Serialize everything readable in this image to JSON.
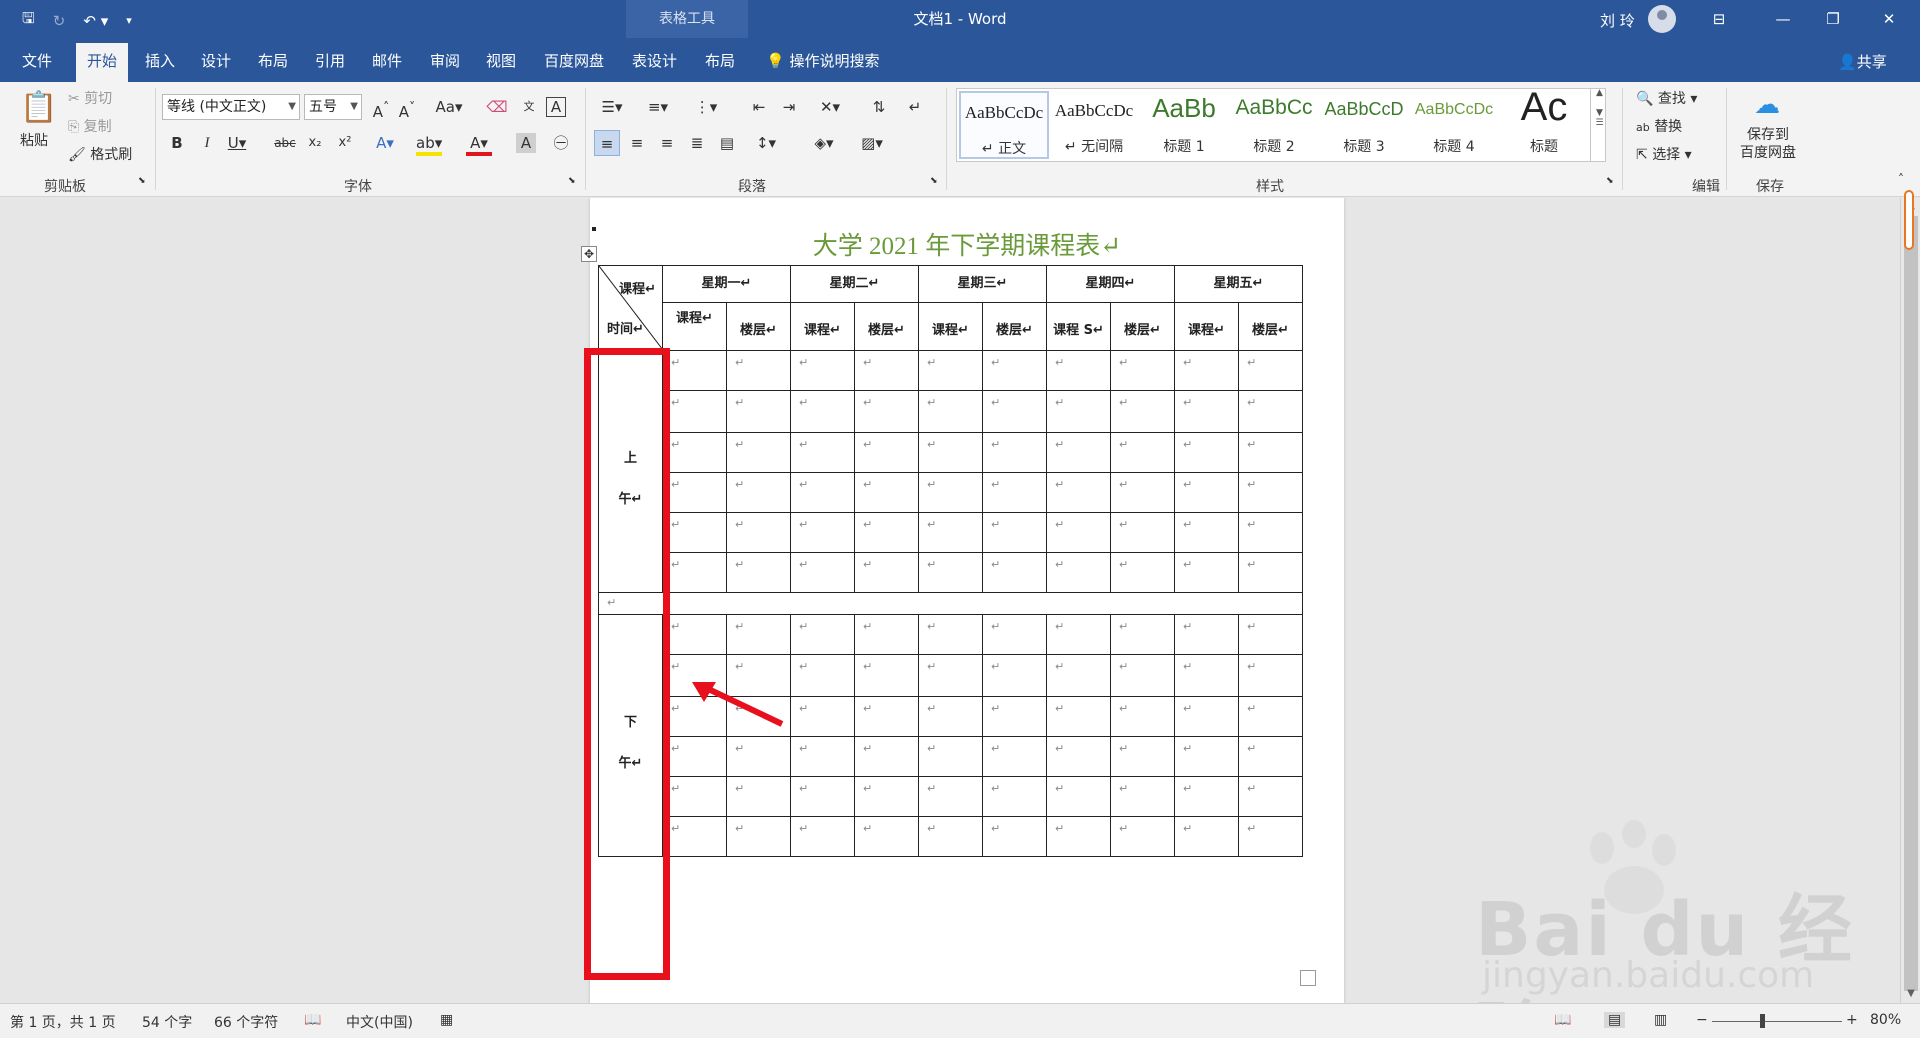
{
  "titlebar": {
    "context_tools": "表格工具",
    "doc_title": "文档1  -  Word",
    "user_name": "刘 玲"
  },
  "tabs": [
    "文件",
    "开始",
    "插入",
    "设计",
    "布局",
    "引用",
    "邮件",
    "审阅",
    "视图",
    "百度网盘",
    "表设计",
    "布局"
  ],
  "tell_me": "操作说明搜索",
  "share": "共享",
  "ribbon": {
    "clipboard": {
      "paste": "粘贴",
      "cut": "剪切",
      "copy": "复制",
      "format_painter": "格式刷",
      "label": "剪贴板"
    },
    "font": {
      "font_name": "等线 (中文正文)",
      "font_size": "五号",
      "label": "字体"
    },
    "paragraph": {
      "label": "段落"
    },
    "styles": {
      "label": "样式",
      "items": [
        {
          "sample": "AaBbCcDc",
          "name": "↵ 正文"
        },
        {
          "sample": "AaBbCcDc",
          "name": "↵ 无间隔"
        },
        {
          "sample": "AaBb",
          "name": "标题 1"
        },
        {
          "sample": "AaBbCc",
          "name": "标题 2"
        },
        {
          "sample": "AaBbCcD",
          "name": "标题 3"
        },
        {
          "sample": "AaBbCcDc",
          "name": "标题 4"
        },
        {
          "sample": "Ac",
          "name": "标题"
        }
      ]
    },
    "editing": {
      "find": "查找",
      "replace": "替换",
      "select": "选择",
      "label": "编辑"
    },
    "save": {
      "button": "保存到\n百度网盘",
      "label": "保存"
    }
  },
  "document": {
    "title": "大学 2021 年下学期课程表↵",
    "header": {
      "corner_top": "课程↵",
      "corner_bottom": "时间↵",
      "corner_mid": "课程↵",
      "days": [
        "星期一↵",
        "星期二↵",
        "星期三↵",
        "星期四↵",
        "星期五↵"
      ],
      "sub": [
        "楼层↵",
        "课程↵",
        "楼层↵",
        "课程↵",
        "楼层↵",
        "课程 S↵",
        "楼层↵",
        "课程↵",
        "楼层↵"
      ]
    },
    "morning": {
      "line1": "上",
      "line2": "午↵"
    },
    "afternoon": {
      "line1": "下",
      "line2": "午↵"
    },
    "cell_mark": "↵",
    "rows_per_block": 6
  },
  "statusbar": {
    "page": "第 1 页，共 1 页",
    "words": "54 个字",
    "chars": "66 个字符",
    "language": "中文(中国)",
    "zoom": "80%"
  },
  "watermark": {
    "main": "Bai du 经验",
    "sub": "jingyan.baidu.com"
  },
  "colors": {
    "accent": "#2b579a",
    "title_green": "#6a9a3a",
    "highlight_red": "#e8101c"
  }
}
